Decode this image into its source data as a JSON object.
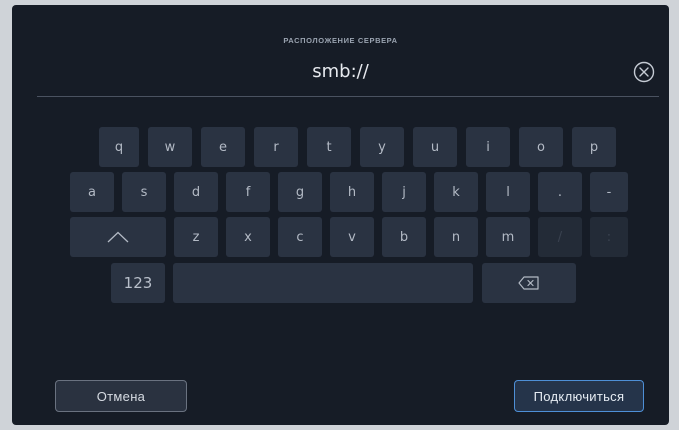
{
  "dialog": {
    "title": "РАСПОЛОЖЕНИЕ СЕРВЕРА",
    "url_value": "smb://",
    "clear_icon": "close-circle-icon"
  },
  "keyboard": {
    "row1": [
      "q",
      "w",
      "e",
      "r",
      "t",
      "y",
      "u",
      "i",
      "o",
      "p"
    ],
    "row2": [
      "a",
      "s",
      "d",
      "f",
      "g",
      "h",
      "j",
      "k",
      "l",
      ".",
      "-"
    ],
    "row3": [
      "z",
      "x",
      "c",
      "v",
      "b",
      "n",
      "m",
      "/",
      ":"
    ],
    "shift_icon": "caret-up-icon",
    "numbers_label": "123",
    "backspace_icon": "backspace-icon"
  },
  "buttons": {
    "cancel_label": "Отмена",
    "connect_label": "Подключиться"
  },
  "colors": {
    "background": "#161c26",
    "key": "#2a3342",
    "accent": "#4e8fd6"
  }
}
